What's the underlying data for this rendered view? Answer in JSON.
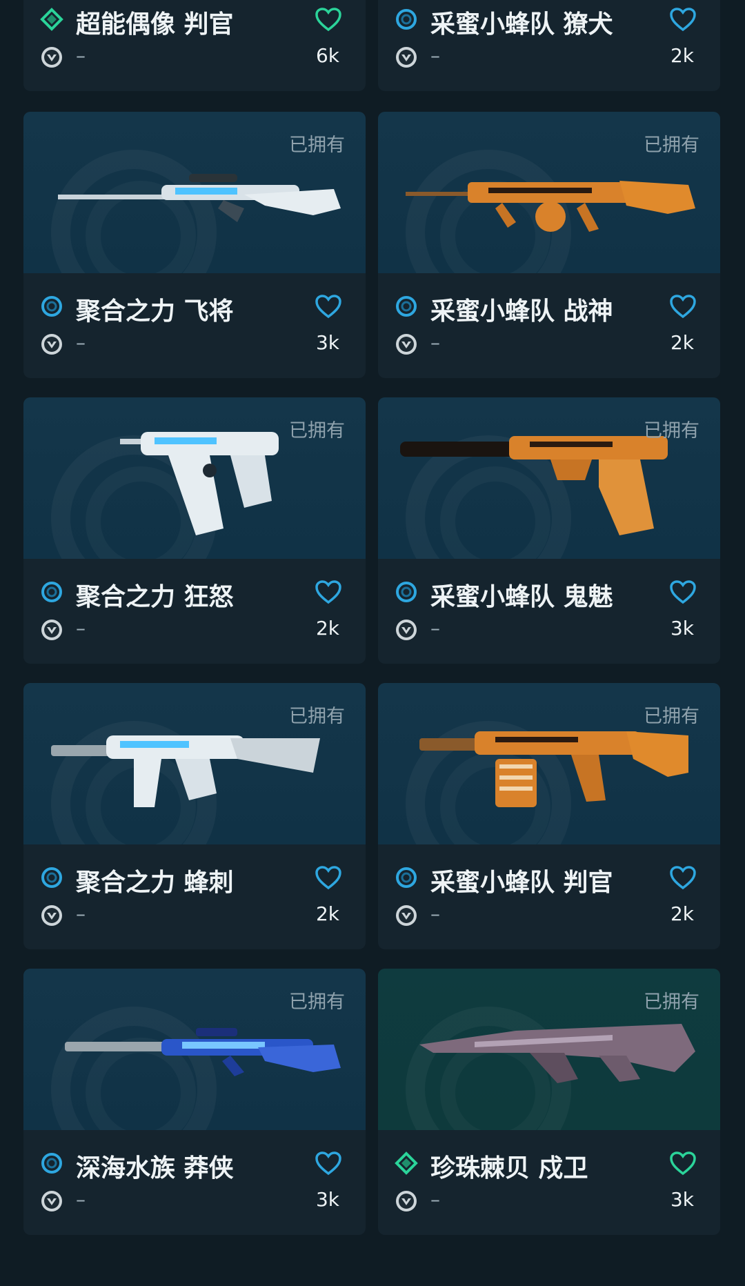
{
  "owned_label": "已拥有",
  "cards": [
    {
      "name": "超能偶像 判官",
      "count": "6k",
      "dash": "–",
      "tier": "green",
      "owned": false,
      "gun": "none"
    },
    {
      "name": "采蜜小蜂队 獠犬",
      "count": "2k",
      "dash": "–",
      "tier": "blue",
      "owned": false,
      "gun": "none"
    },
    {
      "name": "聚合之力 飞将",
      "count": "3k",
      "dash": "–",
      "tier": "blue",
      "owned": true,
      "gun": "sniper-white"
    },
    {
      "name": "采蜜小蜂队 战神",
      "count": "2k",
      "dash": "–",
      "tier": "blue",
      "owned": true,
      "gun": "lmg-orange"
    },
    {
      "name": "聚合之力 狂怒",
      "count": "2k",
      "dash": "–",
      "tier": "blue",
      "owned": true,
      "gun": "smg-white"
    },
    {
      "name": "采蜜小蜂队 鬼魅",
      "count": "3k",
      "dash": "–",
      "tier": "blue",
      "owned": true,
      "gun": "pistol-orange"
    },
    {
      "name": "聚合之力 蜂刺",
      "count": "2k",
      "dash": "–",
      "tier": "blue",
      "owned": true,
      "gun": "smg2-white"
    },
    {
      "name": "采蜜小蜂队 判官",
      "count": "2k",
      "dash": "–",
      "tier": "blue",
      "owned": true,
      "gun": "shotgun-orange"
    },
    {
      "name": "深海水族 莽侠",
      "count": "3k",
      "dash": "–",
      "tier": "blue",
      "owned": true,
      "gun": "sniper-blue"
    },
    {
      "name": "珍珠棘贝 戍卫",
      "count": "3k",
      "dash": "–",
      "tier": "green",
      "owned": true,
      "gun": "rifle-purple"
    }
  ],
  "colors": {
    "blue_tier": "#2ea7e0",
    "green_tier": "#2bd49a",
    "heart_blue": "#2ea7e0",
    "heart_green": "#2bd49a"
  }
}
